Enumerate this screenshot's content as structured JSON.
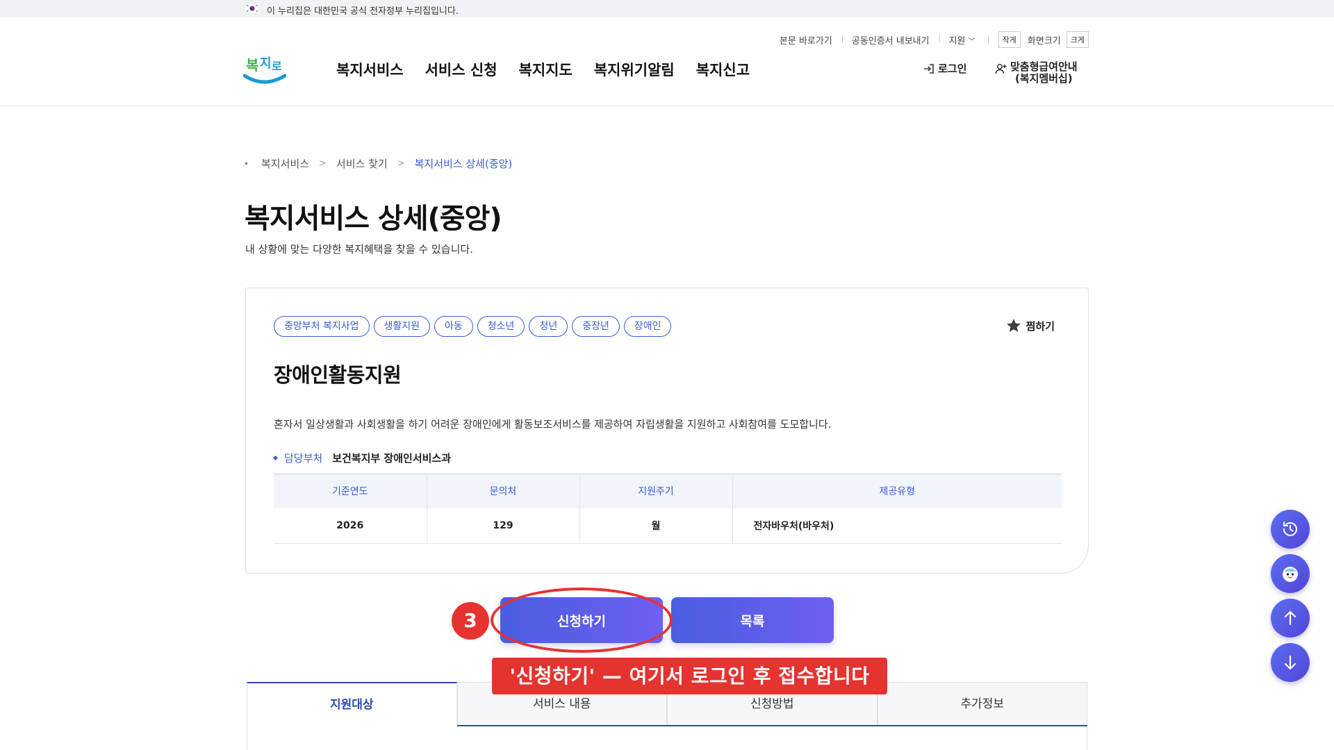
{
  "gov_banner": {
    "text": "이 누리집은 대한민국 공식 전자정부 누리집입니다."
  },
  "header": {
    "util_links": [
      "본문 바로가기",
      "공동인증서 내보내기",
      "지원"
    ],
    "size_small": "작게",
    "size_label": "화면크기",
    "size_large": "크게",
    "logo_text": "복지로",
    "nav": [
      "복지서비스",
      "서비스 신청",
      "복지지도",
      "복지위기알림",
      "복지신고"
    ],
    "login": "로그인",
    "custom_line1": "맞춤형급여안내",
    "custom_line2": "(복지멤버십)"
  },
  "breadcrumb": [
    "복지서비스",
    "서비스 찾기",
    "복지서비스 상세(중앙)"
  ],
  "page": {
    "title": "복지서비스 상세(중앙)",
    "desc": "내 상황에 맞는 다양한 복지혜택을 찾을 수 있습니다."
  },
  "service": {
    "tags": [
      "중앙부처 복지사업",
      "생활지원",
      "아동",
      "청소년",
      "청년",
      "중장년",
      "장애인"
    ],
    "favorite": "찜하기",
    "title": "장애인활동지원",
    "desc": "혼자서 일상생활과 사회생활을 하기 어려운 장애인에게 활동보조서비스를 제공하여 자립생활을 지원하고 사회참여를 도모합니다.",
    "dept_label": "담당부처",
    "dept_value": "보건복지부 장애인서비스과",
    "table": {
      "headers": [
        "기준연도",
        "문의처",
        "지원주기",
        "제공유형"
      ],
      "values": [
        "2026",
        "129",
        "월",
        "전자바우처(바우처)"
      ]
    }
  },
  "actions": {
    "apply": "신청하기",
    "list": "목록"
  },
  "annotation": {
    "step": "3",
    "callout": "'신청하기' — 여기서 로그인 후 접수합니다",
    "color": "#e53330"
  },
  "tabs": [
    "지원대상",
    "서비스 내용",
    "신청방법",
    "추가정보"
  ],
  "colors": {
    "accent": "#3a5ad8",
    "button_start": "#4a5ee0",
    "button_end": "#6e5ff0"
  },
  "floating": [
    "history-icon",
    "chatbot-icon",
    "arrow-up-icon",
    "arrow-down-icon"
  ]
}
